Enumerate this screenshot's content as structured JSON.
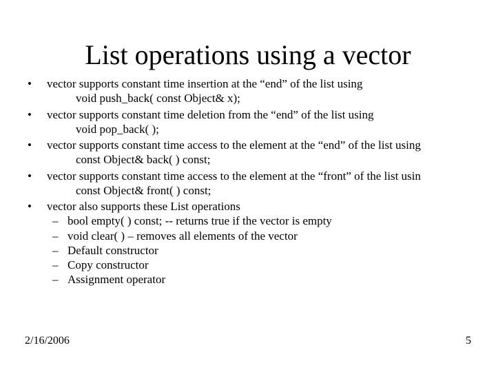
{
  "title": "List operations using a vector",
  "bullets": [
    {
      "text": "vector supports constant time insertion at the “end” of the list using",
      "indent": "void push_back( const Object& x);"
    },
    {
      "text": "vector supports constant time deletion from the “end” of the list using",
      "indent": "void pop_back( );"
    },
    {
      "text": "vector supports constant time access to the element at the “end” of the list using",
      "indent": "const Object& back( ) const;"
    },
    {
      "text": "vector supports constant time access to the element at the “front” of the list usin",
      "indent": "const Object& front( ) const;"
    },
    {
      "text": "vector also supports these List operations",
      "subitems": [
        "bool empty( ) const; -- returns true if the vector is empty",
        "void clear( ) – removes all elements of the vector",
        "Default constructor",
        "Copy constructor",
        "Assignment operator"
      ]
    }
  ],
  "footer": {
    "date": "2/16/2006",
    "page": "5"
  }
}
